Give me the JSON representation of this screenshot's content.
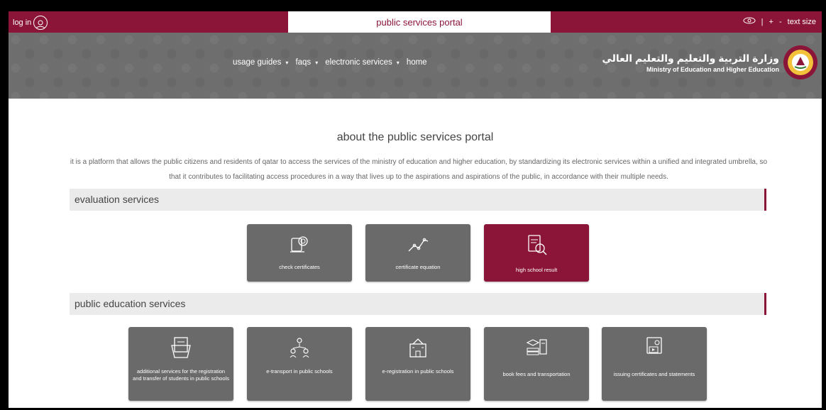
{
  "topbar": {
    "login_label": "log in",
    "portal_title": "public services portal",
    "separator": "|",
    "font_increase": "+",
    "font_decrease": "-",
    "text_size_label": "text size"
  },
  "nav": {
    "items": [
      {
        "label": "usage guides"
      },
      {
        "label": "faqs"
      },
      {
        "label": "electronic services"
      },
      {
        "label": "home"
      }
    ],
    "chevron": "▾"
  },
  "brand": {
    "name_ar": "وزارة التربية والتعليم والتعليم العالي",
    "name_en": "Ministry of Education and Higher Education"
  },
  "about": {
    "title": "about the public services portal",
    "text": "it is a platform that allows the public citizens and residents of qatar to access the services of the ministry of education and higher education, by standardizing its electronic services within a unified and integrated umbrella, so that it contributes to facilitating access procedures in a way that lives up to the aspirations and aspirations of the public, in accordance with their multiple needs."
  },
  "sections": [
    {
      "title": "evaluation services",
      "cards": [
        {
          "label": "check certificates",
          "icon": "certificate-icon"
        },
        {
          "label": "certificate equation",
          "icon": "chart-line-icon"
        },
        {
          "label": "high school result",
          "icon": "document-search-icon",
          "active": true
        }
      ]
    },
    {
      "title": "public education services",
      "cards": [
        {
          "label": "additional services for the registration and transfer of students in public schools",
          "icon": "folder-document-icon"
        },
        {
          "label": "e-transport in public schools",
          "icon": "people-network-icon"
        },
        {
          "label": "e-registration in public schools",
          "icon": "school-building-icon"
        },
        {
          "label": "book fees and transportation",
          "icon": "books-icon"
        },
        {
          "label": "issuing certificates and statements",
          "icon": "certificate-display-icon"
        }
      ]
    }
  ],
  "colors": {
    "brand": "#8a1538",
    "header_gray": "#6e6e6e",
    "card_gray": "#6a6a6a",
    "section_bg": "#ebebeb"
  }
}
